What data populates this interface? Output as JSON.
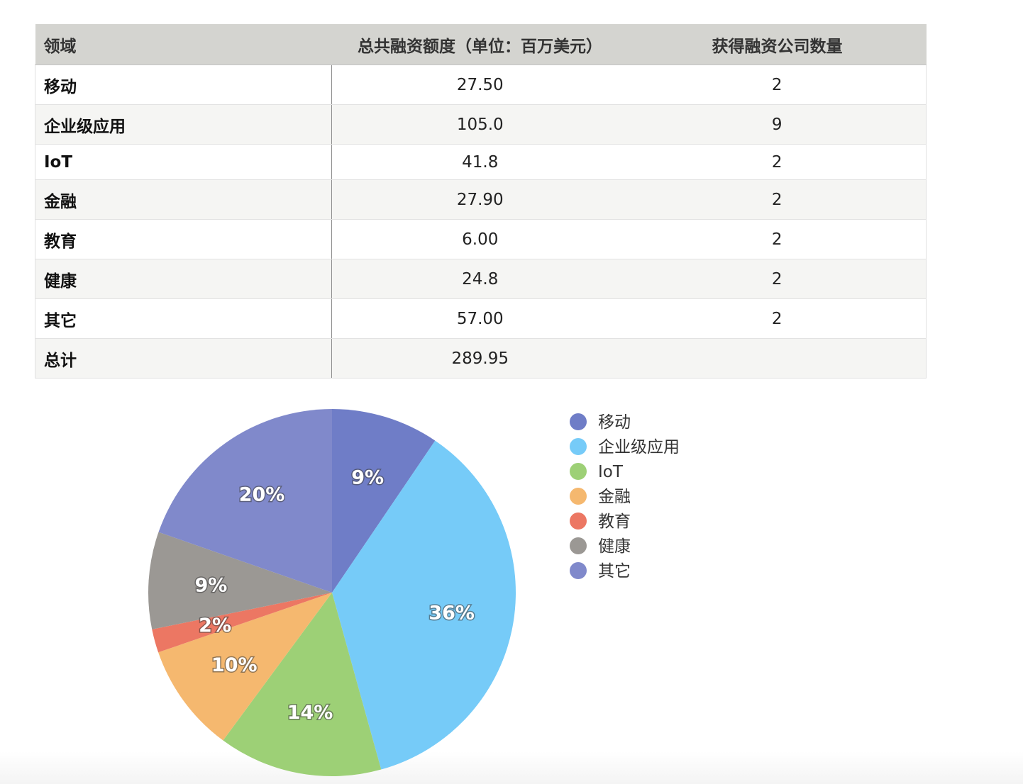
{
  "table": {
    "headers": [
      "领域",
      "总共融资额度（单位：百万美元）",
      "获得融资公司数量"
    ],
    "rows": [
      {
        "label": "移动",
        "amount": "27.50",
        "count": "2"
      },
      {
        "label": "企业级应用",
        "amount": "105.0",
        "count": "9"
      },
      {
        "label": "IoT",
        "amount": "41.8",
        "count": "2"
      },
      {
        "label": "金融",
        "amount": "27.90",
        "count": "2"
      },
      {
        "label": "教育",
        "amount": "6.00",
        "count": "2"
      },
      {
        "label": "健康",
        "amount": "24.8",
        "count": "2"
      },
      {
        "label": "其它",
        "amount": "57.00",
        "count": "2"
      },
      {
        "label": "总计",
        "amount": "289.95",
        "count": ""
      }
    ]
  },
  "chart_data": {
    "type": "pie",
    "title": "",
    "legend_position": "right",
    "slices": [
      {
        "label": "移动",
        "value": 27.5,
        "percent_label": "9%",
        "color": "#6f7dc7"
      },
      {
        "label": "企业级应用",
        "value": 105.0,
        "percent_label": "36%",
        "color": "#76cbf8"
      },
      {
        "label": "IoT",
        "value": 41.8,
        "percent_label": "14%",
        "color": "#9dd076"
      },
      {
        "label": "金融",
        "value": 27.9,
        "percent_label": "10%",
        "color": "#f5b86f"
      },
      {
        "label": "教育",
        "value": 6.0,
        "percent_label": "2%",
        "color": "#ec7763"
      },
      {
        "label": "健康",
        "value": 24.8,
        "percent_label": "9%",
        "color": "#9b9894"
      },
      {
        "label": "其它",
        "value": 57.0,
        "percent_label": "20%",
        "color": "#8089cb"
      }
    ]
  }
}
